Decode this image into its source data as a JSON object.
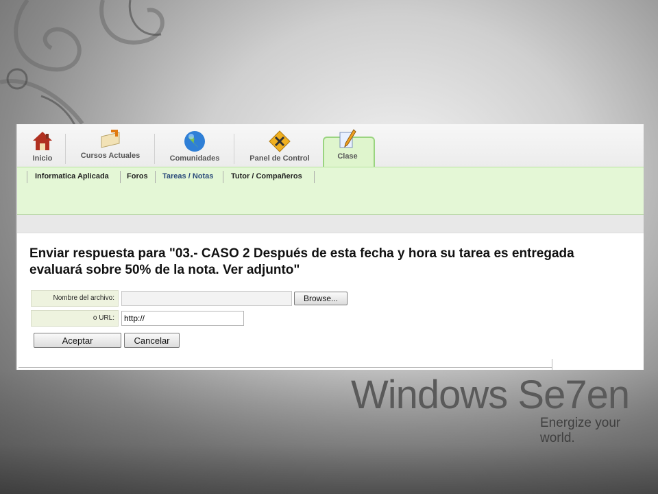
{
  "nav": {
    "items": [
      {
        "label": "Inicio"
      },
      {
        "label": "Cursos Actuales"
      },
      {
        "label": "Comunidades"
      },
      {
        "label": "Panel de Control"
      },
      {
        "label": "Clase"
      }
    ]
  },
  "subnav": {
    "items": [
      {
        "label": "Informatica Aplicada"
      },
      {
        "label": "Foros"
      },
      {
        "label": "Tareas / Notas"
      },
      {
        "label": "Tutor / Compañeros"
      }
    ]
  },
  "page": {
    "heading_line1": "Enviar respuesta para \"03.- CASO 2 Después de esta fecha y hora su tarea es entregada",
    "heading_line2": "evaluará sobre 50% de la nota. Ver adjunto\""
  },
  "form": {
    "file_label": "Nombre del archivo:",
    "browse_label": "Browse...",
    "url_label": "o URL:",
    "url_value": "http://",
    "accept_label": "Aceptar",
    "cancel_label": "Cancelar"
  },
  "desktop": {
    "brand": "Windows Se7en",
    "tagline": "Energize your world."
  },
  "colors": {
    "subnav_bg": "#e4f7d6",
    "active_tab": "#dff5cd",
    "label_bg": "#eef3df"
  }
}
